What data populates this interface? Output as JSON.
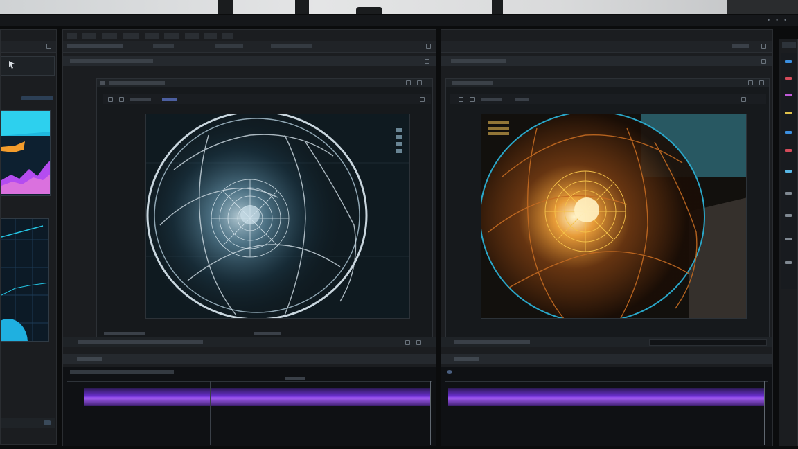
{
  "topbar": {
    "title": "",
    "indicators": [
      "•",
      "•",
      "•"
    ]
  },
  "left_monitor": {
    "badge": "",
    "status": ""
  },
  "center": {
    "menu": [
      "",
      "",
      "",
      "",
      "",
      "",
      "",
      "",
      ""
    ],
    "panel_title": "",
    "viewer_title": "",
    "panel_button": "",
    "timeline_title": "",
    "timeline_button": "",
    "track_label": ""
  },
  "right": {
    "panel_title": "",
    "viewer_title": "",
    "panel_button": "",
    "timeline_title": "",
    "timeline_button": ""
  },
  "colors": {
    "accent_purple": "#8a45e8",
    "scan_blue": "#8fd0e8",
    "scan_orange": "#f2a23a",
    "chart_cyan": "#25c7e6",
    "chart_magenta": "#b44cf0"
  }
}
